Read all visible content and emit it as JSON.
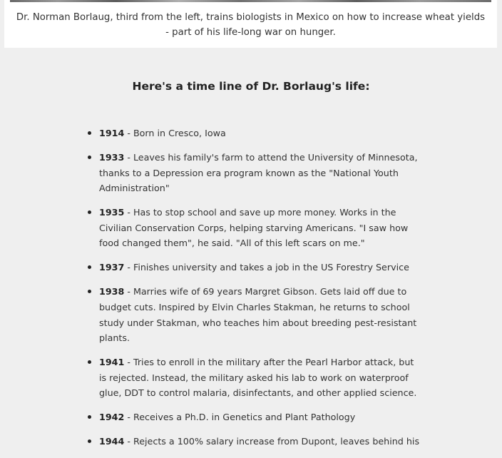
{
  "caption": {
    "text": "Dr. Norman Borlaug, third from the left, trains biologists in Mexico on how to increase wheat yields - part of his life-long war on hunger."
  },
  "timeline": {
    "heading": "Here's a time line of Dr. Borlaug's life:",
    "items": [
      {
        "year": "1914",
        "text": " - Born in Cresco, Iowa"
      },
      {
        "year": "1933",
        "text": " - Leaves his family's farm to attend the University of Minnesota, thanks to a Depression era program known as the \"National Youth Administration\""
      },
      {
        "year": "1935",
        "text": " - Has to stop school and save up more money. Works in the Civilian Conservation Corps, helping starving Americans. \"I saw how food changed them\", he said. \"All of this left scars on me.\""
      },
      {
        "year": "1937",
        "text": " - Finishes university and takes a job in the US Forestry Service"
      },
      {
        "year": "1938",
        "text": " - Marries wife of 69 years Margret Gibson. Gets laid off due to budget cuts. Inspired by Elvin Charles Stakman, he returns to school study under Stakman, who teaches him about breeding pest-resistant plants."
      },
      {
        "year": "1941",
        "text": " - Tries to enroll in the military after the Pearl Harbor attack, but is rejected. Instead, the military asked his lab to work on waterproof glue, DDT to control malaria, disinfectants, and other applied science."
      },
      {
        "year": "1942",
        "text": " - Receives a Ph.D. in Genetics and Plant Pathology"
      },
      {
        "year": "1944",
        "text": " - Rejects a 100% salary increase from Dupont, leaves behind his"
      }
    ]
  }
}
